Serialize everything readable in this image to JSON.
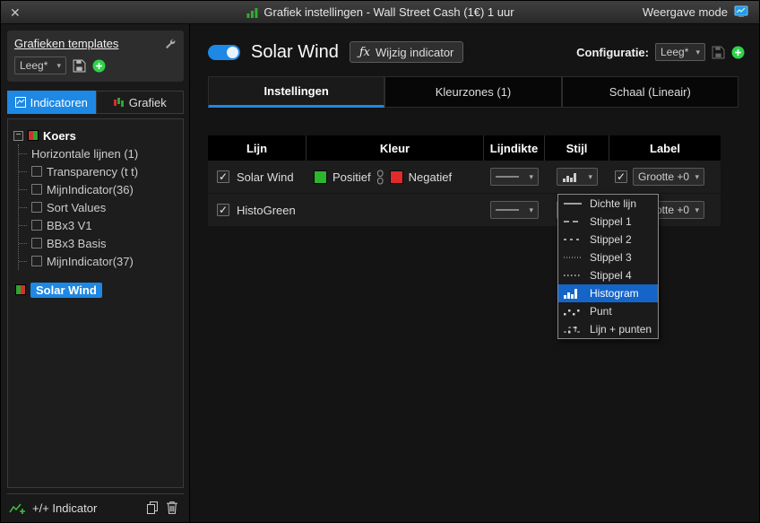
{
  "icons": {
    "check": "✓",
    "chevron_down": "▾",
    "minus": "−",
    "close": "✕"
  },
  "titlebar": {
    "title": "Grafiek instellingen - Wall Street Cash (1€) 1 uur",
    "right_label": "Weergave mode"
  },
  "sidebar": {
    "templates_label": "Grafieken templates",
    "template_select": "Leeg*",
    "tabs": [
      {
        "label": "Indicatoren"
      },
      {
        "label": "Grafiek"
      }
    ],
    "tree": {
      "root": "Koers",
      "children": [
        {
          "label": "Horizontale lijnen (1)",
          "checkbox": false
        },
        {
          "label": "Transparency (t t)",
          "checkbox": true
        },
        {
          "label": "MijnIndicator(36)",
          "checkbox": true
        },
        {
          "label": "Sort Values",
          "checkbox": true
        },
        {
          "label": "BBx3 V1",
          "checkbox": true
        },
        {
          "label": "BBx3 Basis",
          "checkbox": true
        },
        {
          "label": "MijnIndicator(37)",
          "checkbox": true
        }
      ],
      "selected": "Solar Wind"
    },
    "add_indicator_label": "+/+ Indicator"
  },
  "main": {
    "indicator_title": "Solar Wind",
    "edit_button_fx": "ƒx",
    "edit_button": "Wijzig indicator",
    "config_label": "Configuratie:",
    "config_select": "Leeg*",
    "tabs": [
      {
        "label": "Instellingen",
        "active": true
      },
      {
        "label": "Kleurzones (1)",
        "active": false
      },
      {
        "label": "Schaal (Lineair)",
        "active": false
      }
    ],
    "table": {
      "headers": [
        "Lijn",
        "Kleur",
        "Lijndikte",
        "Stijl",
        "Label"
      ],
      "rows": [
        {
          "name": "Solar Wind",
          "checked": true,
          "positive_label": "Positief",
          "negative_label": "Negatief",
          "label_checked": true,
          "label_select": "Grootte +0"
        },
        {
          "name": "HistoGreen",
          "checked": true,
          "label_checked": true,
          "label_select": "Grootte +0"
        }
      ]
    },
    "style_menu": {
      "items": [
        {
          "label": "Dichte lijn",
          "selected": false
        },
        {
          "label": "Stippel 1",
          "selected": false
        },
        {
          "label": "Stippel 2",
          "selected": false
        },
        {
          "label": "Stippel 3",
          "selected": false
        },
        {
          "label": "Stippel 4",
          "selected": false
        },
        {
          "label": "Histogram",
          "selected": true
        },
        {
          "label": "Punt",
          "selected": false
        },
        {
          "label": "Lijn + punten",
          "selected": false
        }
      ]
    }
  },
  "colors": {
    "accent": "#1e88e5",
    "positive": "#2db52d",
    "negative": "#e02b2b",
    "green_plus": "#2fd24a"
  }
}
